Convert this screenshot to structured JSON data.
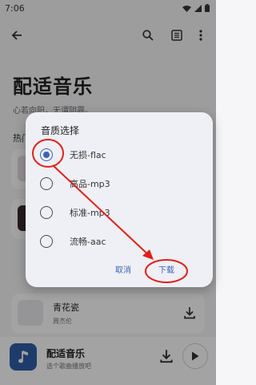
{
  "status_bar": {
    "time": "7:06"
  },
  "page": {
    "title": "配适音乐",
    "subtitle": "心若向阳，无谓阴霾。",
    "section_label": "热门"
  },
  "song_card": {
    "name": "青花瓷",
    "artist": "周杰伦"
  },
  "now_playing": {
    "title": "配适音乐",
    "subtitle": "选个歌曲播放吧"
  },
  "dialog": {
    "title": "音质选择",
    "options": [
      {
        "label": "无损-flac",
        "selected": true
      },
      {
        "label": "高品-mp3",
        "selected": false
      },
      {
        "label": "标准-mp3",
        "selected": false
      },
      {
        "label": "流畅-aac",
        "selected": false
      }
    ],
    "cancel_label": "取消",
    "confirm_label": "下载"
  },
  "colors": {
    "accent": "#3b62b8",
    "annotation_red": "#e0211a",
    "background": "#f6f6f8",
    "dialog_bg": "#eef0f5"
  },
  "icons": [
    "wifi-icon",
    "signal-icon",
    "battery-icon",
    "back-arrow-icon",
    "search-icon",
    "list-icon",
    "more-vertical-icon",
    "download-icon",
    "music-note-icon",
    "play-icon"
  ]
}
